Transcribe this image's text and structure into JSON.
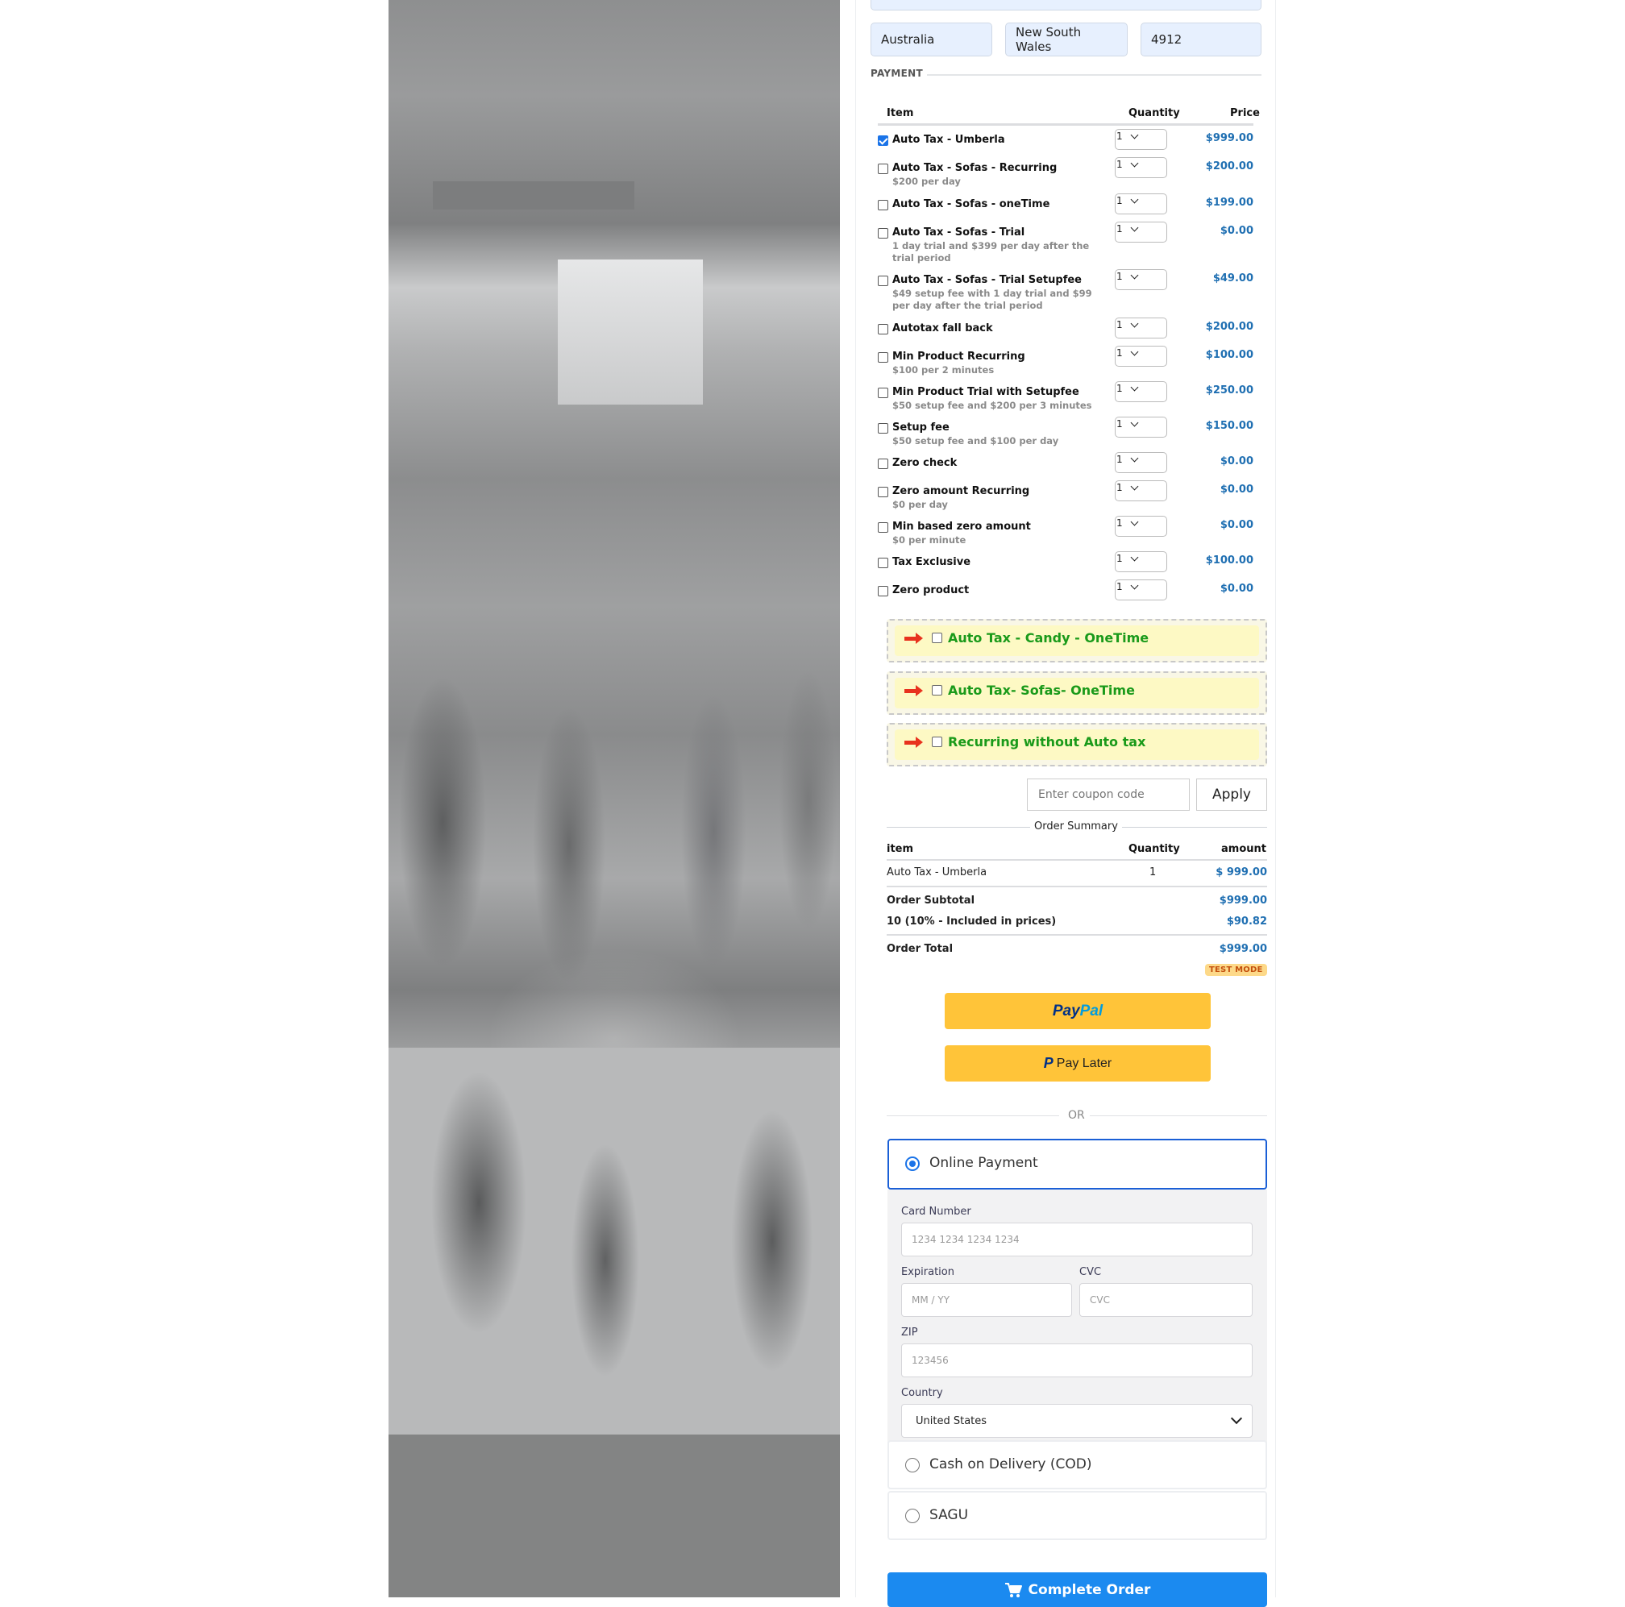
{
  "address": {
    "country": "Australia",
    "state": "New South Wales",
    "postcode": "4912"
  },
  "payment_section": {
    "label": "PAYMENT",
    "columns": {
      "item": "Item",
      "quantity": "Quantity",
      "price": "Price"
    },
    "products": [
      {
        "name": "Auto Tax - Umberla",
        "sub": "",
        "qty": "1",
        "price": "$999.00",
        "checked": true
      },
      {
        "name": "Auto Tax - Sofas - Recurring",
        "sub": "$200 per day",
        "qty": "1",
        "price": "$200.00",
        "checked": false
      },
      {
        "name": "Auto Tax - Sofas - oneTime",
        "sub": "",
        "qty": "1",
        "price": "$199.00",
        "checked": false
      },
      {
        "name": "Auto Tax - Sofas - Trial",
        "sub": "1 day trial and $399 per day after the trial period",
        "qty": "1",
        "price": "$0.00",
        "checked": false
      },
      {
        "name": "Auto Tax - Sofas - Trial Setupfee",
        "sub": "$49 setup fee with 1 day trial and $99 per day after the trial period",
        "qty": "1",
        "price": "$49.00",
        "checked": false
      },
      {
        "name": "Autotax fall back",
        "sub": "",
        "qty": "1",
        "price": "$200.00",
        "checked": false
      },
      {
        "name": "Min Product Recurring",
        "sub": "$100 per 2 minutes",
        "qty": "1",
        "price": "$100.00",
        "checked": false
      },
      {
        "name": "Min Product Trial with Setupfee",
        "sub": "$50 setup fee and $200 per 3 minutes",
        "qty": "1",
        "price": "$250.00",
        "checked": false
      },
      {
        "name": "Setup fee",
        "sub": "$50 setup fee and $100 per day",
        "qty": "1",
        "price": "$150.00",
        "checked": false
      },
      {
        "name": "Zero check",
        "sub": "",
        "qty": "1",
        "price": "$0.00",
        "checked": false
      },
      {
        "name": "Zero amount Recurring",
        "sub": "$0 per day",
        "qty": "1",
        "price": "$0.00",
        "checked": false
      },
      {
        "name": "Min based zero amount",
        "sub": "$0 per minute",
        "qty": "1",
        "price": "$0.00",
        "checked": false
      },
      {
        "name": "Tax Exclusive",
        "sub": "",
        "qty": "1",
        "price": "$100.00",
        "checked": false
      },
      {
        "name": "Zero product",
        "sub": "",
        "qty": "1",
        "price": "$0.00",
        "checked": false
      }
    ]
  },
  "bump_offers": [
    {
      "label": "Auto Tax - Candy - OneTime",
      "checked": false
    },
    {
      "label": "Auto Tax- Sofas- OneTime",
      "checked": false
    },
    {
      "label": "Recurring without Auto tax",
      "checked": false
    }
  ],
  "coupon": {
    "placeholder": "Enter coupon code",
    "apply_label": "Apply"
  },
  "order_summary": {
    "title": "Order Summary",
    "columns": {
      "item": "item",
      "quantity": "Quantity",
      "amount": "amount"
    },
    "lines": [
      {
        "item": "Auto Tax - Umberla",
        "qty": "1",
        "amount": "$ 999.00"
      }
    ],
    "subtotal_label": "Order Subtotal",
    "subtotal": "$999.00",
    "tax_label": "10 (10% - Included in prices)",
    "tax": "$90.82",
    "total_label": "Order Total",
    "total": "$999.00",
    "mode_badge": "TEST MODE"
  },
  "paypal": {
    "logo_pay": "Pay",
    "logo_pal": "Pal",
    "pay_later_mark": "P",
    "pay_later_label": "Pay Later"
  },
  "divider_or": "OR",
  "payment_methods": {
    "online": {
      "label": "Online Payment",
      "selected": true
    },
    "card": {
      "number_label": "Card Number",
      "number_placeholder": "1234 1234 1234 1234",
      "exp_label": "Expiration",
      "exp_placeholder": "MM / YY",
      "cvc_label": "CVC",
      "cvc_placeholder": "CVC",
      "zip_label": "ZIP",
      "zip_placeholder": "123456",
      "country_label": "Country",
      "country_value": "United States"
    },
    "cod": {
      "label": "Cash on Delivery (COD)",
      "selected": false
    },
    "sagu": {
      "label": "SAGU",
      "selected": false
    }
  },
  "complete_order": {
    "label": "Complete Order"
  },
  "colors": {
    "accent_blue": "#1b8af0",
    "price_blue": "#1f6fb2",
    "bump_green": "#1a9a1a",
    "paypal_yellow": "#ffc439"
  }
}
